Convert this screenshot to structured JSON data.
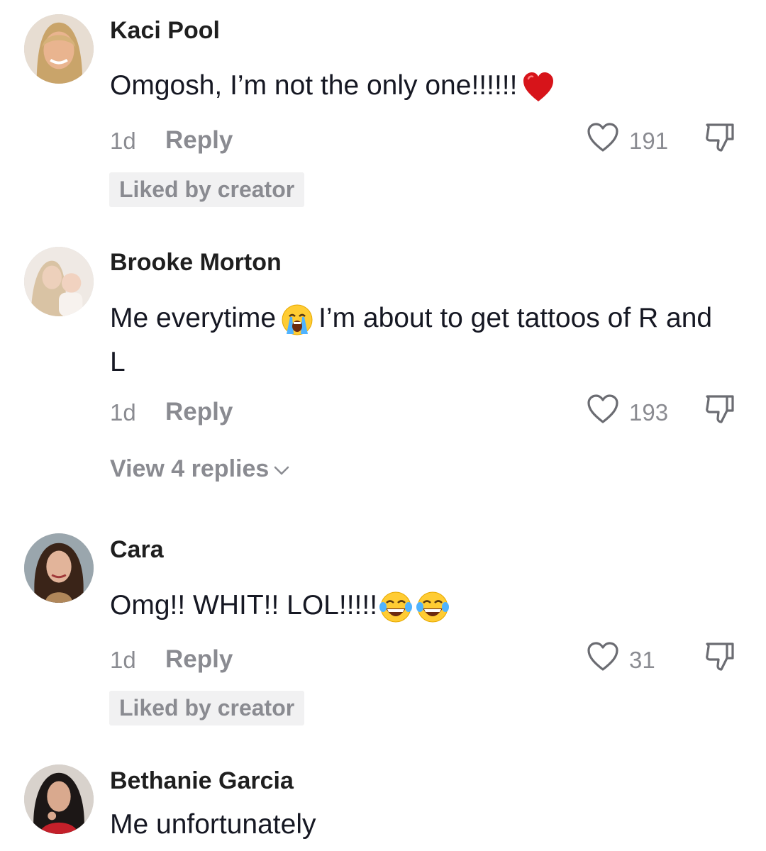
{
  "comments": [
    {
      "username": "Kaci Pool",
      "text": "Omgosh, I’m not the only one!!!!!!",
      "trailing_emoji": "red-heart",
      "age": "1d",
      "reply_label": "Reply",
      "likes": "191",
      "badge": "Liked by creator"
    },
    {
      "username": "Brooke Morton",
      "text_before": "Me everytime",
      "inline_emoji": "loudly-crying-face",
      "text_after": "I’m about to get tattoos of R and L",
      "age": "1d",
      "reply_label": "Reply",
      "likes": "193",
      "view_replies": "View 4 replies"
    },
    {
      "username": "Cara",
      "text": "Omg!! WHIT!! LOL!!!!!",
      "trailing_emojis": [
        "face-with-tears-of-joy",
        "face-with-tears-of-joy"
      ],
      "age": "1d",
      "reply_label": "Reply",
      "likes": "31",
      "badge": "Liked by creator"
    },
    {
      "username": "Bethanie Garcia",
      "text": "Me unfortunately"
    }
  ],
  "icons": {
    "like": "heart-outline-icon",
    "dislike": "thumbs-down-outline-icon",
    "expand": "chevron-down-icon"
  },
  "colors": {
    "muted_text": "#8a8b91",
    "badge_bg": "#f1f1f2",
    "primary_text": "#161823"
  }
}
